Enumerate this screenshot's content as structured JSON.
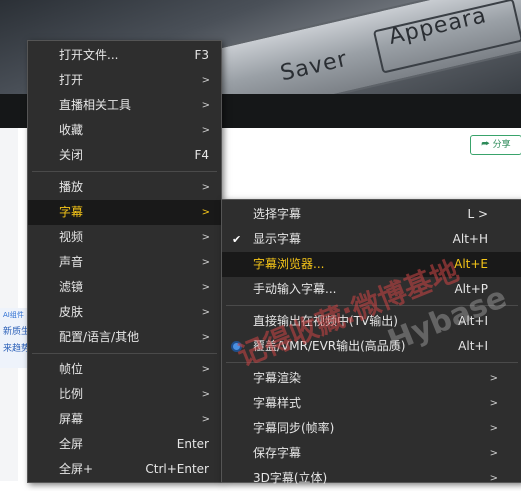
{
  "background": {
    "video_words": [
      "Saver",
      "Appeara"
    ],
    "share_label": "⮫ 分享",
    "side_tag": "AI组件",
    "side_text1": "新质生",
    "side_text2": "来趋势"
  },
  "menu_main": {
    "items": [
      {
        "label": "打开文件...",
        "key": "F3"
      },
      {
        "label": "打开",
        "arrow": ">"
      },
      {
        "label": "直播相关工具",
        "arrow": ">"
      },
      {
        "label": "收藏",
        "arrow": ">"
      },
      {
        "label": "关闭",
        "key": "F4"
      },
      {
        "label": "播放",
        "arrow": ">"
      },
      {
        "label": "字幕",
        "arrow": ">"
      },
      {
        "label": "视频",
        "arrow": ">"
      },
      {
        "label": "声音",
        "arrow": ">"
      },
      {
        "label": "滤镜",
        "arrow": ">"
      },
      {
        "label": "皮肤",
        "arrow": ">"
      },
      {
        "label": "配置/语言/其他",
        "arrow": ">"
      },
      {
        "label": "帧位",
        "arrow": ">"
      },
      {
        "label": "比例",
        "arrow": ">"
      },
      {
        "label": "屏幕",
        "arrow": ">"
      },
      {
        "label": "全屏",
        "key": "Enter"
      },
      {
        "label": "全屏+",
        "key": "Ctrl+Enter"
      }
    ]
  },
  "menu_subtitle": {
    "items": [
      {
        "label": "选择字幕",
        "key": "L >"
      },
      {
        "label": "显示字幕",
        "key": "Alt+H"
      },
      {
        "label": "字幕浏览器...",
        "key": "Alt+E"
      },
      {
        "label": "手动输入字幕...",
        "key": "Alt+P"
      },
      {
        "label": "直接输出在视频中(TV输出)",
        "key": "Alt+I"
      },
      {
        "label": "覆盖/VMR/EVR输出(高品质)",
        "key": "Alt+I"
      },
      {
        "label": "字幕渲染",
        "arrow": ">"
      },
      {
        "label": "字幕样式",
        "arrow": ">"
      },
      {
        "label": "字幕同步(帧率)",
        "arrow": ">"
      },
      {
        "label": "保存字幕",
        "arrow": ">"
      },
      {
        "label": "3D字幕(立体)",
        "arrow": ">"
      }
    ]
  },
  "watermark": {
    "cn": "记得收藏:微博基地",
    "en": "Hybase"
  },
  "colors": {
    "highlight_text": "#f5c518",
    "menu_bg": "#2e2e2e",
    "radio": "#4a90e2"
  }
}
